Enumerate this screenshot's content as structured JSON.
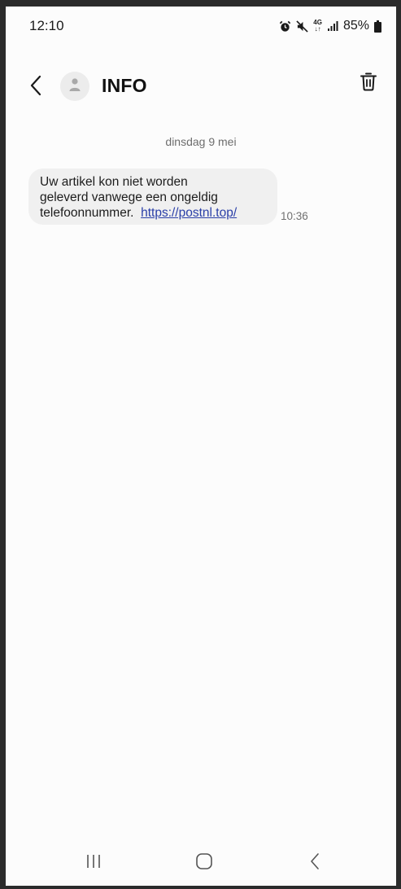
{
  "status_bar": {
    "time": "12:10",
    "network": "4G",
    "battery": "85%",
    "icons": [
      "alarm-icon",
      "mute-icon",
      "network-4g-icon",
      "signal-icon",
      "battery-icon"
    ]
  },
  "header": {
    "contact_name": "INFO",
    "icons": [
      "back-arrow-icon",
      "person-icon",
      "trash-icon"
    ]
  },
  "conversation": {
    "date_label": "dinsdag 9 mei",
    "messages": [
      {
        "text_line1": "Uw artikel kon niet worden",
        "text_line2": "geleverd vanwege een ongeldig",
        "text_line3": "telefoonnummer.",
        "link": "https://postnl.top/",
        "time": "10:36"
      }
    ]
  },
  "nav_bar": {
    "icons": [
      "recent-apps-icon",
      "home-icon",
      "back-icon"
    ]
  },
  "colors": {
    "background": "#fcfcfc",
    "bubble": "#f0f0f0",
    "link": "#2a3fa8",
    "muted_text": "#6d6d6d"
  }
}
